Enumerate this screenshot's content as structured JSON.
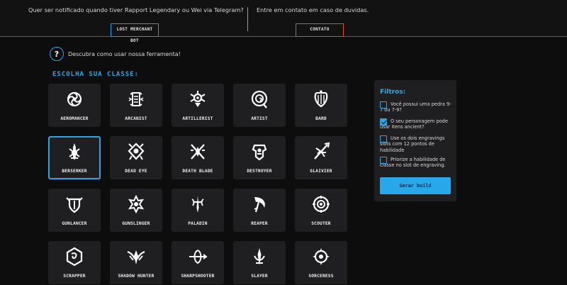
{
  "topbar": {
    "telegram_text": "Quer ser notificado quando tiver Rapport Legendary ou Wei via Telegram?",
    "bot_button": "LOST MERCHANT BOT",
    "contact_text": "Entre em contato em caso de duvidas.",
    "contact_button": "CONTATO"
  },
  "help": {
    "icon": "question-icon",
    "symbol": "?",
    "text": "Descubra como usar nossa ferramenta!"
  },
  "section_title": "ESCOLHA SUA CLASSE:",
  "selected_class": "BERSERKER",
  "classes": [
    {
      "label": "AEROMANCER",
      "icon": "aeromancer-icon"
    },
    {
      "label": "ARCANIST",
      "icon": "arcanist-icon"
    },
    {
      "label": "ARTILLERIST",
      "icon": "artillerist-icon"
    },
    {
      "label": "ARTIST",
      "icon": "artist-icon"
    },
    {
      "label": "BARD",
      "icon": "bard-icon"
    },
    {
      "label": "BERSERKER",
      "icon": "berserker-icon"
    },
    {
      "label": "DEAD EYE",
      "icon": "deadeye-icon"
    },
    {
      "label": "DEATH BLADE",
      "icon": "deathblade-icon"
    },
    {
      "label": "DESTROYER",
      "icon": "destroyer-icon"
    },
    {
      "label": "GLAIVIER",
      "icon": "glaivier-icon"
    },
    {
      "label": "GUNLANCER",
      "icon": "gunlancer-icon"
    },
    {
      "label": "GUNSLINGER",
      "icon": "gunslinger-icon"
    },
    {
      "label": "PALADIN",
      "icon": "paladin-icon"
    },
    {
      "label": "REAPER",
      "icon": "reaper-icon"
    },
    {
      "label": "SCOUTER",
      "icon": "scouter-icon"
    },
    {
      "label": "SCRAPPER",
      "icon": "scrapper-icon"
    },
    {
      "label": "SHADOW HUNTER",
      "icon": "shadowhunter-icon"
    },
    {
      "label": "SHARPSHOOTER",
      "icon": "sharpshooter-icon"
    },
    {
      "label": "SLAYER",
      "icon": "slayer-icon"
    },
    {
      "label": "SORCERESS",
      "icon": "sorceress-icon"
    }
  ],
  "filters": {
    "title": "Filtros:",
    "options": [
      {
        "text": "Você possui uma pedra 9-7 ou 7-9?",
        "checked": false
      },
      {
        "text": "O seu personagem pode usar itens ancient?",
        "checked": true
      },
      {
        "text": "Use os dois engravings slots com 12 pontos de habilidade",
        "checked": false
      },
      {
        "text": "Priorize a habilidade de classe no slot de engraving.",
        "checked": false
      }
    ],
    "generate_button": "Gerar build"
  },
  "colors": {
    "accent": "#29a8ea",
    "contact_border": "#e0521b",
    "card_bg": "#1f1f21",
    "page_bg": "#0d0d0e"
  }
}
